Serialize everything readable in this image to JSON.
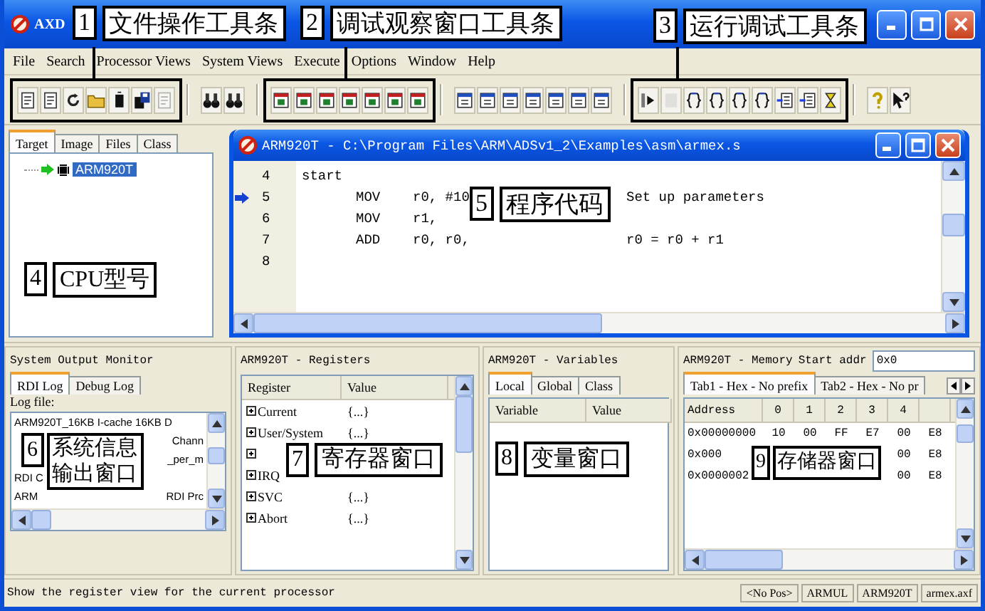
{
  "window": {
    "title": "AXD"
  },
  "annotations": [
    {
      "number": "1",
      "label": "文件操作工具条"
    },
    {
      "number": "2",
      "label": "调试观察窗口工具条"
    },
    {
      "number": "3",
      "label": "运行调试工具条"
    },
    {
      "number": "4",
      "label": "CPU型号"
    },
    {
      "number": "5",
      "label": "程序代码"
    },
    {
      "number": "6",
      "label": "系统信息输出窗口"
    },
    {
      "number": "7",
      "label": "寄存器窗口"
    },
    {
      "number": "8",
      "label": "变量窗口"
    },
    {
      "number": "9",
      "label": "存储器窗口"
    }
  ],
  "menu": [
    "File",
    "Search",
    "Processor Views",
    "System Views",
    "Execute",
    "Options",
    "Window",
    "Help"
  ],
  "toolbar": {
    "groups": [
      {
        "buttons": [
          {
            "disabled": false
          },
          {
            "disabled": false
          },
          {
            "disabled": false
          },
          {
            "disabled": false
          },
          {
            "disabled": false
          },
          {
            "disabled": false
          },
          {
            "disabled": true
          }
        ]
      },
      {
        "buttons": [
          {
            "disabled": false
          },
          {
            "disabled": false
          }
        ]
      },
      {
        "buttons": [
          {
            "disabled": false
          },
          {
            "disabled": false
          },
          {
            "disabled": false
          },
          {
            "disabled": false
          },
          {
            "disabled": false
          },
          {
            "disabled": false
          },
          {
            "disabled": false
          }
        ]
      },
      {
        "buttons": [
          {
            "disabled": false
          },
          {
            "disabled": false
          },
          {
            "disabled": false
          },
          {
            "disabled": false
          },
          {
            "disabled": false
          },
          {
            "disabled": false
          },
          {
            "disabled": false
          }
        ]
      },
      {
        "buttons": [
          {
            "disabled": false
          },
          {
            "disabled": true
          },
          {
            "disabled": false
          },
          {
            "disabled": false
          },
          {
            "disabled": false
          },
          {
            "disabled": false
          },
          {
            "disabled": false
          },
          {
            "disabled": false
          },
          {
            "disabled": false
          }
        ]
      },
      {
        "buttons": [
          {
            "disabled": false
          },
          {
            "disabled": false
          }
        ]
      }
    ]
  },
  "target_panel": {
    "tabs": [
      {
        "label": "Target",
        "selected": true
      },
      {
        "label": "Image",
        "selected": false
      },
      {
        "label": "Files",
        "selected": false
      },
      {
        "label": "Class",
        "selected": false
      }
    ],
    "tree": [
      {
        "label": "ARM920T",
        "selected": true
      }
    ]
  },
  "source_window": {
    "title": "ARM920T - C:\\Program Files\\ARM\\ADSv1_2\\Examples\\asm\\armex.s",
    "lines": [
      {
        "number": "4",
        "label": "start",
        "current": false
      },
      {
        "number": "5",
        "mnemonic": "MOV",
        "operands": "r0, #10",
        "comment": "Set up parameters",
        "current": true
      },
      {
        "number": "6",
        "mnemonic": "MOV",
        "operands": "r1,",
        "current": false
      },
      {
        "number": "7",
        "mnemonic": "ADD",
        "operands": "r0, r0,",
        "comment": "r0 = r0 + r1",
        "current": false
      },
      {
        "number": "8",
        "current": false
      }
    ]
  },
  "output_monitor": {
    "title": "System Output Monitor",
    "tabs": [
      {
        "label": "RDI Log",
        "selected": true
      },
      {
        "label": "Debug Log",
        "selected": false
      }
    ],
    "log_label": "Log file:",
    "log_lines": [
      {
        "left": "ARM920T_16KB I-cache 16KB D"
      },
      {
        "right": "Chann"
      },
      {
        "right": "_per_m"
      },
      {
        "left": "RDI C"
      },
      {
        "left": "ARM",
        "right": "RDI Prc"
      }
    ]
  },
  "registers": {
    "title": "ARM920T - Registers",
    "columns": [
      "Register",
      "Value"
    ],
    "rows": [
      {
        "name": "Current",
        "value": "{...}",
        "expanded": false
      },
      {
        "name": "User/System",
        "value": "{...}",
        "expanded": false
      },
      {
        "expanded": false
      },
      {
        "name": "IRQ",
        "expanded": false
      },
      {
        "name": "SVC",
        "value": "{...}",
        "expanded": false
      },
      {
        "name": "Abort",
        "value": "{...}",
        "expanded": false
      }
    ]
  },
  "variables": {
    "title": "ARM920T - Variables",
    "tabs": [
      {
        "label": "Local",
        "selected": true
      },
      {
        "label": "Global",
        "selected": false
      },
      {
        "label": "Class",
        "selected": false
      }
    ],
    "columns": [
      "Variable",
      "Value"
    ]
  },
  "memory": {
    "title": "ARM920T - Memory",
    "start_label": "Start addr",
    "start_value": "0x0",
    "tabs": [
      {
        "label": "Tab1 - Hex - No prefix",
        "selected": true
      },
      {
        "label": "Tab2 - Hex - No pr",
        "selected": false
      }
    ],
    "columns": [
      "Address",
      "0",
      "1",
      "2",
      "3",
      "4"
    ],
    "rows": [
      {
        "cells": [
          "0x00000000",
          "10",
          "00",
          "FF",
          "E7",
          "00",
          "E8"
        ]
      },
      {
        "cells": [
          "0x000",
          "",
          "",
          "",
          "",
          "00",
          "E8"
        ]
      },
      {
        "cells": [
          "0x0000002",
          "",
          "",
          "",
          "",
          "00",
          "E8"
        ]
      }
    ]
  },
  "status_bar": {
    "message": "Show the register view for the current processor",
    "panels": [
      "<No Pos>",
      "ARMUL",
      "ARM920T",
      "armex.axf"
    ]
  }
}
